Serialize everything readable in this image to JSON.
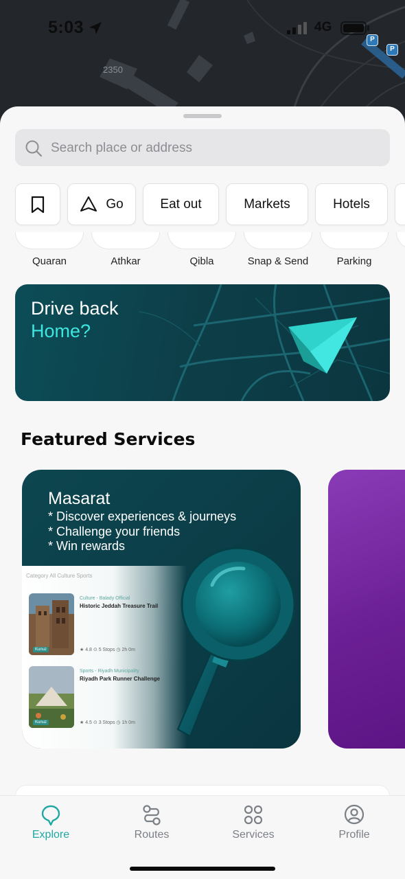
{
  "status_bar": {
    "time": "5:03",
    "network": "4G"
  },
  "map": {
    "label": "2350",
    "parking_badge": "P"
  },
  "search": {
    "placeholder": "Search place or address"
  },
  "chips": [
    {
      "label": "",
      "icon": "bookmark-icon"
    },
    {
      "label": "Go",
      "icon": "navigation-icon"
    },
    {
      "label": "Eat out"
    },
    {
      "label": "Markets"
    },
    {
      "label": "Hotels"
    }
  ],
  "quick_actions": [
    "Quaran",
    "Athkar",
    "Qibla",
    "Snap & Send",
    "Parking"
  ],
  "banner": {
    "line1": "Drive back",
    "line2": "Home?",
    "accent_color": "#3ee6df"
  },
  "featured": {
    "title": "Featured Services",
    "cards": [
      {
        "title": "Masarat",
        "bullets": [
          "* Discover experiences & journeys",
          "* Challenge your friends",
          "* Win rewards"
        ],
        "preview": {
          "filters": "Category   All   Culture   Sports",
          "items": [
            {
              "tag": "Culture - Balady Official",
              "title": "Historic Jeddah Treasure Trail",
              "meta": "★ 4.8   ⊙ 5 Stops   ◷ 2h 0m",
              "chip": "Kunuz"
            },
            {
              "tag": "Sports - Riyadh Municipality",
              "title": "Riyadh Park Runner Challenge",
              "meta": "★ 4.5   ⊙ 3 Stops   ◷ 1h 0m",
              "chip": "Kunuz"
            }
          ]
        }
      }
    ]
  },
  "tabs": [
    {
      "label": "Explore",
      "icon": "explore-icon",
      "active": true
    },
    {
      "label": "Routes",
      "icon": "routes-icon",
      "active": false
    },
    {
      "label": "Services",
      "icon": "services-icon",
      "active": false
    },
    {
      "label": "Profile",
      "icon": "profile-icon",
      "active": false
    }
  ],
  "colors": {
    "accent": "#1fa8a2",
    "banner_bg": "#0d3f49",
    "card2_bg": "#7a2aa6"
  }
}
